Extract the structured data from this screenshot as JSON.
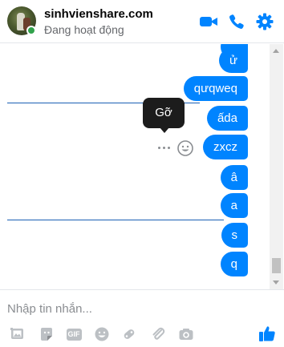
{
  "header": {
    "contact_name": "sinhvienshare.com",
    "status": "Đang hoạt động",
    "icons": [
      "video-call-icon",
      "phone-icon",
      "settings-gear-icon"
    ],
    "accent_color": "#0084ff"
  },
  "messages": [
    {
      "text": ""
    },
    {
      "text": "ử"
    },
    {
      "text": "qưqweq"
    },
    {
      "text": "ấda"
    },
    {
      "text": "zxcz"
    },
    {
      "text": "â"
    },
    {
      "text": "a"
    },
    {
      "text": "s"
    },
    {
      "text": "q"
    }
  ],
  "hover_actions": {
    "tooltip": "Gỡ",
    "icons": [
      "more-dots-icon",
      "emoji-reaction-icon"
    ]
  },
  "composer": {
    "placeholder": "Nhập tin nhắn...",
    "tools": [
      "photo-icon",
      "sticker-icon",
      "gif-icon",
      "emoji-icon",
      "game-controller-icon",
      "attachment-icon",
      "camera-icon",
      "thumbs-up-icon"
    ],
    "gif_label": "GIF"
  }
}
